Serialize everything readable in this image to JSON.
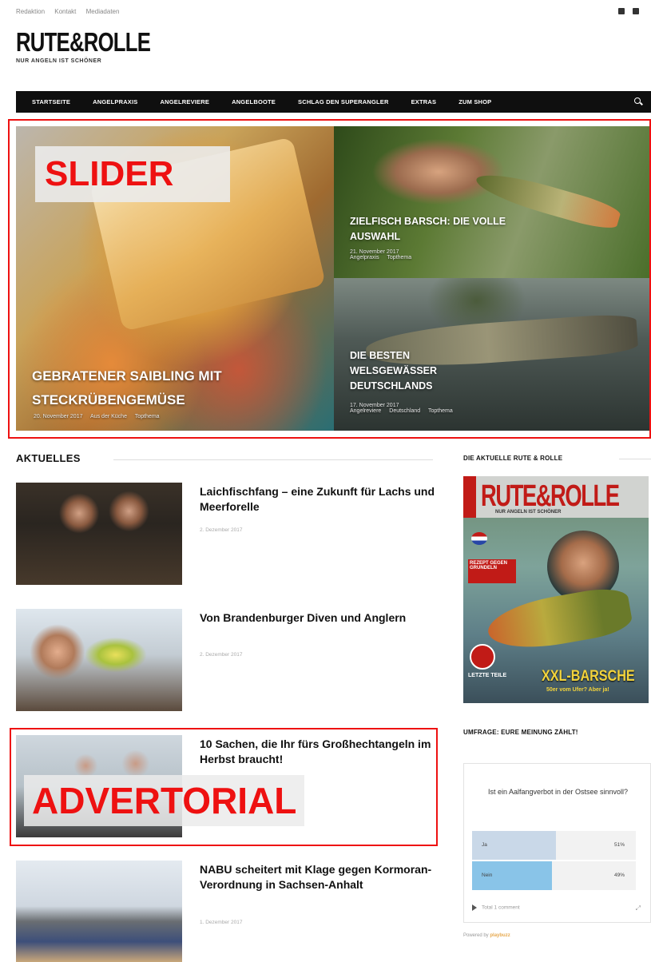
{
  "top_links": [
    "Redaktion",
    "Kontakt",
    "Mediadaten"
  ],
  "brand": {
    "name": "RUTE&ROLLE",
    "tagline": "NUR ANGELN IST SCHÖNER"
  },
  "nav": [
    "STARTSEITE",
    "ANGELPRAXIS",
    "ANGELREVIERE",
    "ANGELBOOTE",
    "SCHLAG DEN SUPERANGLER",
    "EXTRAS",
    "ZUM SHOP"
  ],
  "slider": {
    "label": "SLIDER",
    "main": {
      "title": "GEBRATENER SAIBLING MIT STECKRÜBENGEMÜSE",
      "date": "20. November 2017",
      "cats": [
        "Aus der Küche",
        "Topthema"
      ]
    },
    "top": {
      "title": "ZIELFISCH BARSCH: DIE VOLLE AUSWAHL",
      "date": "21. November 2017",
      "cats": [
        "Angelpraxis",
        "Topthema"
      ]
    },
    "bottom": {
      "title": "DIE BESTEN WELSGEWÄSSER DEUTSCHLANDS",
      "date": "17. November 2017",
      "cats": [
        "Angelreviere",
        "Deutschland",
        "Topthema"
      ]
    }
  },
  "section_title": "AKTUELLES",
  "articles": [
    {
      "title": "Laichfischfang – eine Zukunft für Lachs und Meerforelle",
      "date": "2. Dezember 2017"
    },
    {
      "title": "Von Brandenburger Diven und Anglern",
      "date": "2. Dezember 2017"
    },
    {
      "title": "10 Sachen, die Ihr fürs Großhechtangeln im Herbst braucht!",
      "date": ""
    },
    {
      "title": "NABU scheitert mit Klage gegen Kormoran-Verordnung in Sachsen-Anhalt",
      "date": "1. Dezember 2017"
    }
  ],
  "advertorial_label": "ADVERTORIAL",
  "sidebar": {
    "magazine_head": "DIE AKTUELLE RUTE & ROLLE",
    "magazine": {
      "logo": "RUTE&ROLLE",
      "tagline": "NUR ANGELN IST SCHÖNER",
      "tease": "REZEPT GEGEN GRUNDELN",
      "letzte": "LETZTE TEILE",
      "headline": "XXL-BARSCHE",
      "sub": "50er vom Ufer? Aber ja!"
    },
    "poll_head": "UMFRAGE: EURE MEINUNG ZÄHLT!",
    "poll": {
      "question": "Ist ein Aalfangverbot in der Ostsee sinnvoll?",
      "options": [
        {
          "label": "Ja",
          "pct": "51%",
          "fraction": 0.51
        },
        {
          "label": "Nein",
          "pct": "49%",
          "fraction": 0.49
        }
      ],
      "footer": "Total 1 comment"
    },
    "powered_prefix": "Powered by",
    "powered_brand": "playbuzz"
  }
}
